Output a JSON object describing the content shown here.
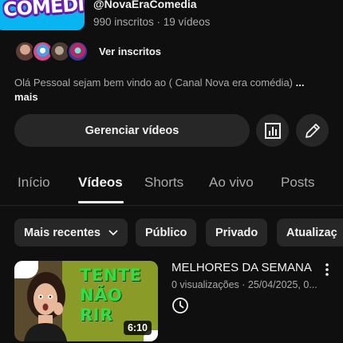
{
  "channel": {
    "logo_text": "COMÉDIA",
    "handle": "@NovaEraComedia",
    "stats": "990 inscritos · 19 vídeos",
    "subscribers_link": "Ver inscritos",
    "description": "Olá Pessoal sejam bem vindo ao ( Canal Nova era comédia)",
    "description_ellipsis": "...",
    "description_more": "mais"
  },
  "actions": {
    "manage_label": "Gerenciar vídeos",
    "analytics_icon": "analytics-icon",
    "edit_icon": "pencil-icon"
  },
  "tabs": [
    {
      "label": "Início",
      "active": false
    },
    {
      "label": "Vídeos",
      "active": true
    },
    {
      "label": "Shorts",
      "active": false
    },
    {
      "label": "Ao vivo",
      "active": false
    },
    {
      "label": "Posts",
      "active": false
    }
  ],
  "filters": [
    {
      "label": "Mais recentes",
      "has_dropdown": true
    },
    {
      "label": "Público"
    },
    {
      "label": "Privado"
    },
    {
      "label": "Atualizaç"
    }
  ],
  "videos": [
    {
      "thumbnail_text": [
        "TENTE",
        "NÃO",
        "RIR"
      ],
      "duration": "6:10",
      "title": "MELHORES DA SEMANA",
      "meta": "0 visualizações · 25/04/2025, 0...",
      "status_icon": "clock-icon",
      "menu_icon": "more-vertical-icon"
    }
  ],
  "colors": {
    "background": "#0f0f0f",
    "surface": "#272727",
    "text_primary": "#f1f1f1",
    "text_secondary": "#aaaaaa",
    "thumbnail_text": "#2ce04a"
  }
}
